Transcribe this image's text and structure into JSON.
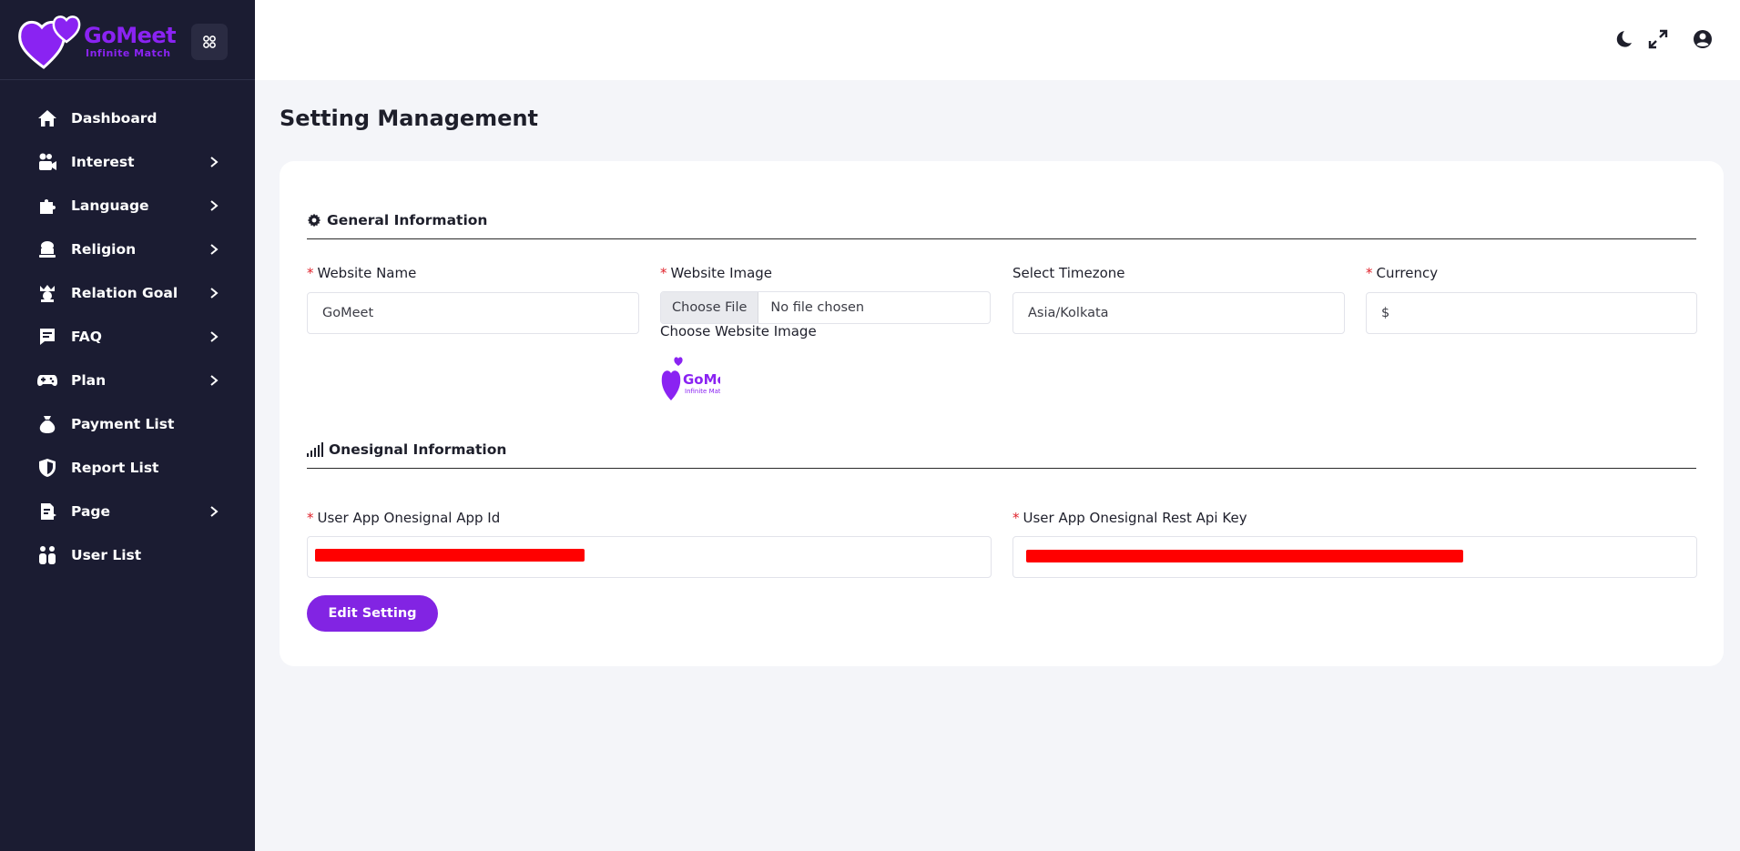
{
  "brand": {
    "name": "GoMeet",
    "tagline": "Infinite Match"
  },
  "sidebar": {
    "items": [
      {
        "label": "Dashboard",
        "icon": "home-icon",
        "has_children": false
      },
      {
        "label": "Interest",
        "icon": "interest-icon",
        "has_children": true
      },
      {
        "label": "Language",
        "icon": "puzzle-icon",
        "has_children": true
      },
      {
        "label": "Religion",
        "icon": "religion-icon",
        "has_children": true
      },
      {
        "label": "Relation Goal",
        "icon": "crown-icon",
        "has_children": true
      },
      {
        "label": "FAQ",
        "icon": "faq-icon",
        "has_children": true
      },
      {
        "label": "Plan",
        "icon": "gamepad-icon",
        "has_children": true
      },
      {
        "label": "Payment List",
        "icon": "money-bag-icon",
        "has_children": false
      },
      {
        "label": "Report List",
        "icon": "shield-icon",
        "has_children": false
      },
      {
        "label": "Page",
        "icon": "page-icon",
        "has_children": true
      },
      {
        "label": "User List",
        "icon": "users-icon",
        "has_children": false
      }
    ]
  },
  "topbar": {
    "icons": [
      "moon-icon",
      "fullscreen-icon",
      "user-circle-icon"
    ]
  },
  "page": {
    "title": "Setting Management"
  },
  "general": {
    "title": "General Information",
    "website_name": {
      "label": "Website Name",
      "value": "GoMeet"
    },
    "website_image": {
      "label": "Website Image",
      "button": "Choose File",
      "status": "No file chosen",
      "hint": "Choose Website Image"
    },
    "timezone": {
      "label": "Select Timezone",
      "value": "Asia/Kolkata"
    },
    "currency": {
      "label": "Currency",
      "value": "$"
    }
  },
  "onesignal": {
    "title": "Onesignal Information",
    "app_id": {
      "label": "User App Onesignal App Id"
    },
    "rest_key": {
      "label": "User App Onesignal Rest Api Key"
    }
  },
  "actions": {
    "edit": "Edit Setting"
  },
  "colors": {
    "sidebar_bg": "#1b1c32",
    "accent": "#8224e3",
    "required": "#e0222b",
    "redaction": "#ff0000"
  }
}
